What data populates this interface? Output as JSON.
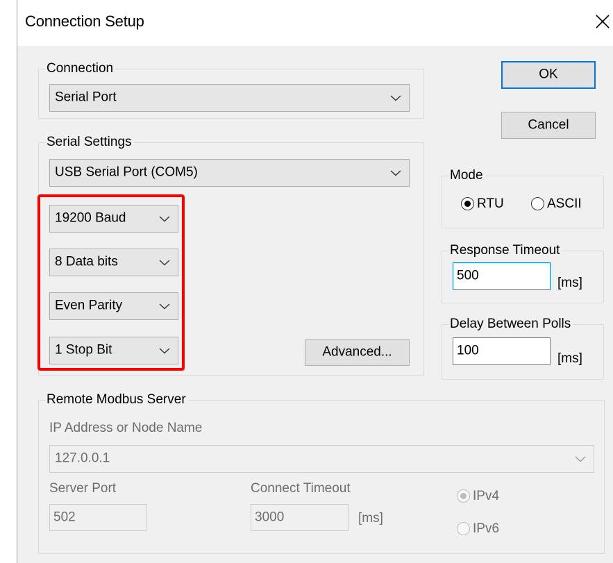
{
  "dialog": {
    "title": "Connection Setup",
    "close_icon": "close-x-icon"
  },
  "connection": {
    "legend": "Connection",
    "type_value": "Serial Port"
  },
  "serial_settings": {
    "legend": "Serial Settings",
    "port_value": "USB Serial Port (COM5)",
    "baud_value": "19200 Baud",
    "data_bits_value": "8 Data bits",
    "parity_value": "Even Parity",
    "stop_bits_value": "1 Stop Bit",
    "advanced_label": "Advanced..."
  },
  "buttons": {
    "ok_label": "OK",
    "cancel_label": "Cancel"
  },
  "mode": {
    "legend": "Mode",
    "rtu_label": "RTU",
    "ascii_label": "ASCII",
    "selected": "RTU"
  },
  "response_timeout": {
    "legend": "Response Timeout",
    "value": "500",
    "unit": "[ms]"
  },
  "delay_between_polls": {
    "legend": "Delay Between Polls",
    "value": "100",
    "unit": "[ms]"
  },
  "remote_server": {
    "legend": "Remote Modbus Server",
    "ip_label": "IP Address or Node Name",
    "ip_value": "127.0.0.1",
    "port_label": "Server Port",
    "port_value": "502",
    "connect_timeout_label": "Connect Timeout",
    "connect_timeout_value": "3000",
    "connect_timeout_unit": "[ms]",
    "ipv4_label": "IPv4",
    "ipv6_label": "IPv6",
    "selected_ip_version": "IPv4"
  },
  "colors": {
    "highlight": "#ff0000",
    "focus_border": "#0078d7",
    "dialog_bg": "#f0f0f0"
  }
}
